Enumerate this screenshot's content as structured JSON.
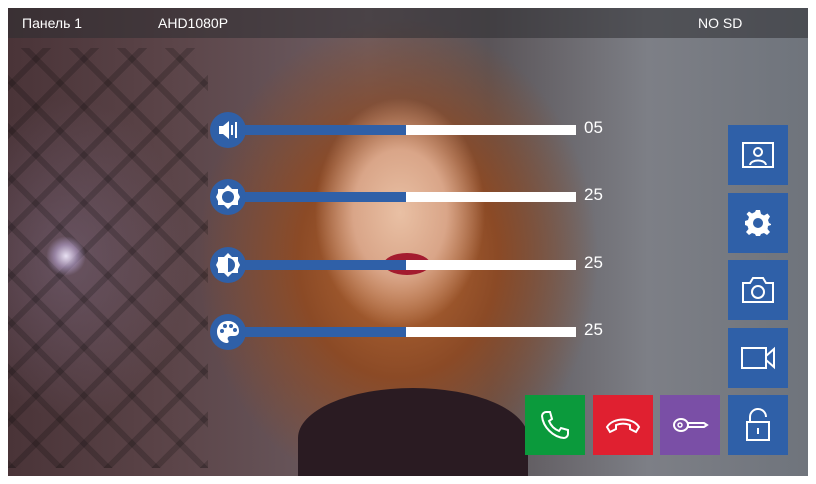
{
  "status_bar": {
    "panel": "Панель 1",
    "resolution": "AHD1080P",
    "sd": "NO SD"
  },
  "sliders": [
    {
      "name": "volume",
      "icon": "volume-icon",
      "value": "05",
      "fill_fraction": 0.5
    },
    {
      "name": "brightness",
      "icon": "brightness-icon",
      "value": "25",
      "fill_fraction": 0.5
    },
    {
      "name": "contrast",
      "icon": "contrast-icon",
      "value": "25",
      "fill_fraction": 0.5
    },
    {
      "name": "color",
      "icon": "palette-icon",
      "value": "25",
      "fill_fraction": 0.5
    }
  ],
  "side_buttons": [
    "gallery-icon",
    "settings-gear-icon",
    "camera-icon",
    "video-record-icon",
    "unlock-icon"
  ],
  "call_buttons": [
    "answer-phone-icon",
    "hangup-phone-icon",
    "key-icon"
  ],
  "colors": {
    "accent_blue": "#2f60a8",
    "answer_green": "#0b9a3c",
    "hangup_red": "#e02030",
    "key_purple": "#7a4fa6"
  }
}
